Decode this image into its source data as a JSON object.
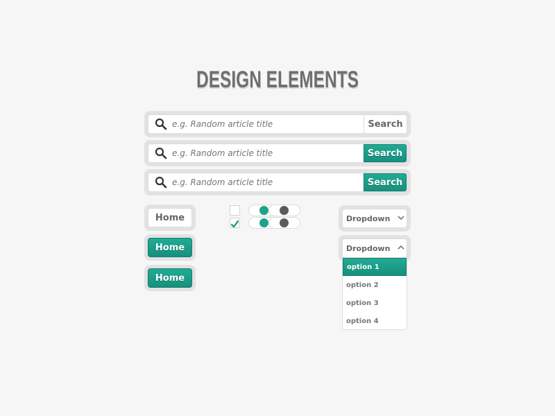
{
  "title": "DESIGN ELEMENTS",
  "colors": {
    "accent": "#1b9e88",
    "background": "#f6f6f6",
    "knob_dark": "#5a5a5a"
  },
  "search_bars": [
    {
      "placeholder": "e.g. Random article title",
      "button_label": "Search",
      "button_style": "plain",
      "icon": "search-icon"
    },
    {
      "placeholder": "e.g. Random article title",
      "button_label": "Search",
      "button_style": "teal",
      "icon": "search-icon"
    },
    {
      "placeholder": "e.g. Random article title",
      "button_label": "Search",
      "button_style": "teal",
      "icon": "search-icon"
    }
  ],
  "home_buttons": [
    {
      "label": "Home",
      "style": "plain"
    },
    {
      "label": "Home",
      "style": "teal"
    },
    {
      "label": "Home",
      "style": "teal"
    }
  ],
  "checkboxes": [
    {
      "checked": false
    },
    {
      "checked": true,
      "icon": "check-icon"
    }
  ],
  "toggles": [
    {
      "knob_color": "teal",
      "state": "on"
    },
    {
      "knob_color": "dark",
      "state": "off"
    },
    {
      "knob_color": "teal",
      "state": "on"
    },
    {
      "knob_color": "dark",
      "state": "off"
    }
  ],
  "dropdowns": [
    {
      "label": "Dropdown",
      "expanded": false,
      "icon": "chevron-down-icon"
    },
    {
      "label": "Dropdown",
      "expanded": true,
      "icon": "chevron-up-icon",
      "options": [
        "option 1",
        "option 2",
        "option 3",
        "option 4"
      ],
      "selected": "option 1"
    }
  ]
}
